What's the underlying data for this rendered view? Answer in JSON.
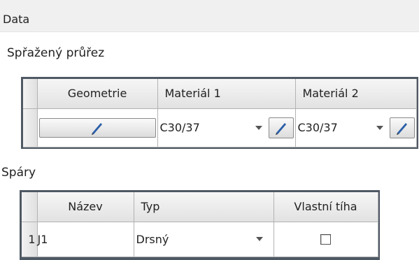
{
  "panel": {
    "title": "Data"
  },
  "composite_section": {
    "label": "Spřažený průřez",
    "columns": [
      "Geometrie",
      "Materiál 1",
      "Materiál 2"
    ],
    "row": {
      "material1_value": "C30/37",
      "material2_value": "C30/37"
    }
  },
  "joints_section": {
    "label": "Spáry",
    "columns": [
      "Název",
      "Typ",
      "Vlastní tíha"
    ],
    "rows": [
      {
        "index": "1",
        "name": "J1",
        "type": "Drsný",
        "self_weight": false
      }
    ]
  },
  "icons": {
    "edit": "pencil-icon",
    "dropdown": "chevron-down-icon"
  },
  "colors": {
    "grid_border": "#4f5964",
    "pencil": "#2b5fa8"
  }
}
